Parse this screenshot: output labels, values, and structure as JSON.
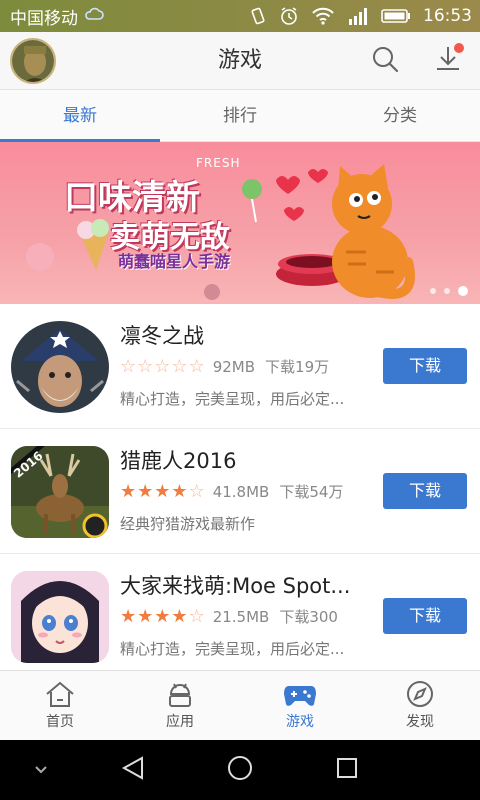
{
  "status_bar": {
    "carrier": "中国移动",
    "time": "16:53",
    "icons": [
      "cloud-icon",
      "vibrate-icon",
      "alarm-icon",
      "wifi-icon",
      "signal-icon",
      "battery-icon"
    ]
  },
  "header": {
    "title": "游戏",
    "icons": [
      "avatar",
      "search-icon",
      "download-icon"
    ]
  },
  "tabs": [
    {
      "label": "最新",
      "active": true
    },
    {
      "label": "排行",
      "active": false
    },
    {
      "label": "分类",
      "active": false
    }
  ],
  "banner": {
    "line1": "口味清新",
    "fresh": "FRESH",
    "line2": "卖萌无敌",
    "line3": "萌蠢喵星人手游",
    "page_count": 3,
    "active_page": 3
  },
  "apps": [
    {
      "name": "凛冬之战",
      "rating": 0,
      "size": "92MB",
      "downloads": "下载19万",
      "desc": "精心打造，完美呈现，用后必定...",
      "button": "下载"
    },
    {
      "name": "猎鹿人2016",
      "rating": 4,
      "size": "41.8MB",
      "downloads": "下载54万",
      "desc": "经典狩猎游戏最新作",
      "button": "下载",
      "icon_text": "2016"
    },
    {
      "name": "大家来找萌:Moe Spot...",
      "rating": 4,
      "size": "21.5MB",
      "downloads": "下载300",
      "desc": "精心打造，完美呈现，用后必定...",
      "button": "下载"
    }
  ],
  "bottom_nav": [
    {
      "label": "首页",
      "icon": "home-icon",
      "active": false
    },
    {
      "label": "应用",
      "icon": "android-icon",
      "active": false
    },
    {
      "label": "游戏",
      "icon": "gamepad-icon",
      "active": true
    },
    {
      "label": "发现",
      "icon": "compass-icon",
      "active": false
    }
  ],
  "colors": {
    "accent": "#3b78d0",
    "star": "#f07c3f",
    "banner": "#f88d9c",
    "badge": "#f05a4a"
  }
}
